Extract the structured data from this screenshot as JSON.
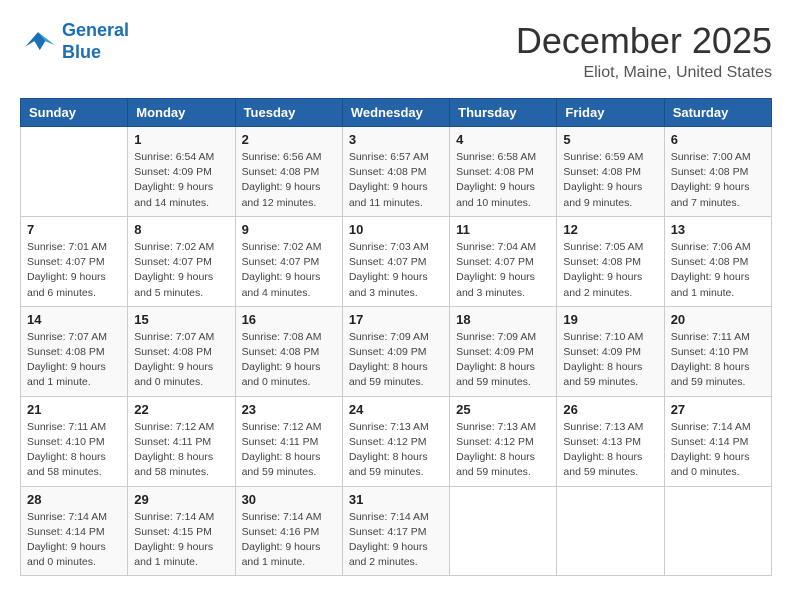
{
  "header": {
    "logo_line1": "General",
    "logo_line2": "Blue",
    "month": "December 2025",
    "location": "Eliot, Maine, United States"
  },
  "weekdays": [
    "Sunday",
    "Monday",
    "Tuesday",
    "Wednesday",
    "Thursday",
    "Friday",
    "Saturday"
  ],
  "weeks": [
    [
      {
        "day": "",
        "info": ""
      },
      {
        "day": "1",
        "info": "Sunrise: 6:54 AM\nSunset: 4:09 PM\nDaylight: 9 hours\nand 14 minutes."
      },
      {
        "day": "2",
        "info": "Sunrise: 6:56 AM\nSunset: 4:08 PM\nDaylight: 9 hours\nand 12 minutes."
      },
      {
        "day": "3",
        "info": "Sunrise: 6:57 AM\nSunset: 4:08 PM\nDaylight: 9 hours\nand 11 minutes."
      },
      {
        "day": "4",
        "info": "Sunrise: 6:58 AM\nSunset: 4:08 PM\nDaylight: 9 hours\nand 10 minutes."
      },
      {
        "day": "5",
        "info": "Sunrise: 6:59 AM\nSunset: 4:08 PM\nDaylight: 9 hours\nand 9 minutes."
      },
      {
        "day": "6",
        "info": "Sunrise: 7:00 AM\nSunset: 4:08 PM\nDaylight: 9 hours\nand 7 minutes."
      }
    ],
    [
      {
        "day": "7",
        "info": "Sunrise: 7:01 AM\nSunset: 4:07 PM\nDaylight: 9 hours\nand 6 minutes."
      },
      {
        "day": "8",
        "info": "Sunrise: 7:02 AM\nSunset: 4:07 PM\nDaylight: 9 hours\nand 5 minutes."
      },
      {
        "day": "9",
        "info": "Sunrise: 7:02 AM\nSunset: 4:07 PM\nDaylight: 9 hours\nand 4 minutes."
      },
      {
        "day": "10",
        "info": "Sunrise: 7:03 AM\nSunset: 4:07 PM\nDaylight: 9 hours\nand 3 minutes."
      },
      {
        "day": "11",
        "info": "Sunrise: 7:04 AM\nSunset: 4:07 PM\nDaylight: 9 hours\nand 3 minutes."
      },
      {
        "day": "12",
        "info": "Sunrise: 7:05 AM\nSunset: 4:08 PM\nDaylight: 9 hours\nand 2 minutes."
      },
      {
        "day": "13",
        "info": "Sunrise: 7:06 AM\nSunset: 4:08 PM\nDaylight: 9 hours\nand 1 minute."
      }
    ],
    [
      {
        "day": "14",
        "info": "Sunrise: 7:07 AM\nSunset: 4:08 PM\nDaylight: 9 hours\nand 1 minute."
      },
      {
        "day": "15",
        "info": "Sunrise: 7:07 AM\nSunset: 4:08 PM\nDaylight: 9 hours\nand 0 minutes."
      },
      {
        "day": "16",
        "info": "Sunrise: 7:08 AM\nSunset: 4:08 PM\nDaylight: 9 hours\nand 0 minutes."
      },
      {
        "day": "17",
        "info": "Sunrise: 7:09 AM\nSunset: 4:09 PM\nDaylight: 8 hours\nand 59 minutes."
      },
      {
        "day": "18",
        "info": "Sunrise: 7:09 AM\nSunset: 4:09 PM\nDaylight: 8 hours\nand 59 minutes."
      },
      {
        "day": "19",
        "info": "Sunrise: 7:10 AM\nSunset: 4:09 PM\nDaylight: 8 hours\nand 59 minutes."
      },
      {
        "day": "20",
        "info": "Sunrise: 7:11 AM\nSunset: 4:10 PM\nDaylight: 8 hours\nand 59 minutes."
      }
    ],
    [
      {
        "day": "21",
        "info": "Sunrise: 7:11 AM\nSunset: 4:10 PM\nDaylight: 8 hours\nand 58 minutes."
      },
      {
        "day": "22",
        "info": "Sunrise: 7:12 AM\nSunset: 4:11 PM\nDaylight: 8 hours\nand 58 minutes."
      },
      {
        "day": "23",
        "info": "Sunrise: 7:12 AM\nSunset: 4:11 PM\nDaylight: 8 hours\nand 59 minutes."
      },
      {
        "day": "24",
        "info": "Sunrise: 7:13 AM\nSunset: 4:12 PM\nDaylight: 8 hours\nand 59 minutes."
      },
      {
        "day": "25",
        "info": "Sunrise: 7:13 AM\nSunset: 4:12 PM\nDaylight: 8 hours\nand 59 minutes."
      },
      {
        "day": "26",
        "info": "Sunrise: 7:13 AM\nSunset: 4:13 PM\nDaylight: 8 hours\nand 59 minutes."
      },
      {
        "day": "27",
        "info": "Sunrise: 7:14 AM\nSunset: 4:14 PM\nDaylight: 9 hours\nand 0 minutes."
      }
    ],
    [
      {
        "day": "28",
        "info": "Sunrise: 7:14 AM\nSunset: 4:14 PM\nDaylight: 9 hours\nand 0 minutes."
      },
      {
        "day": "29",
        "info": "Sunrise: 7:14 AM\nSunset: 4:15 PM\nDaylight: 9 hours\nand 1 minute."
      },
      {
        "day": "30",
        "info": "Sunrise: 7:14 AM\nSunset: 4:16 PM\nDaylight: 9 hours\nand 1 minute."
      },
      {
        "day": "31",
        "info": "Sunrise: 7:14 AM\nSunset: 4:17 PM\nDaylight: 9 hours\nand 2 minutes."
      },
      {
        "day": "",
        "info": ""
      },
      {
        "day": "",
        "info": ""
      },
      {
        "day": "",
        "info": ""
      }
    ]
  ]
}
